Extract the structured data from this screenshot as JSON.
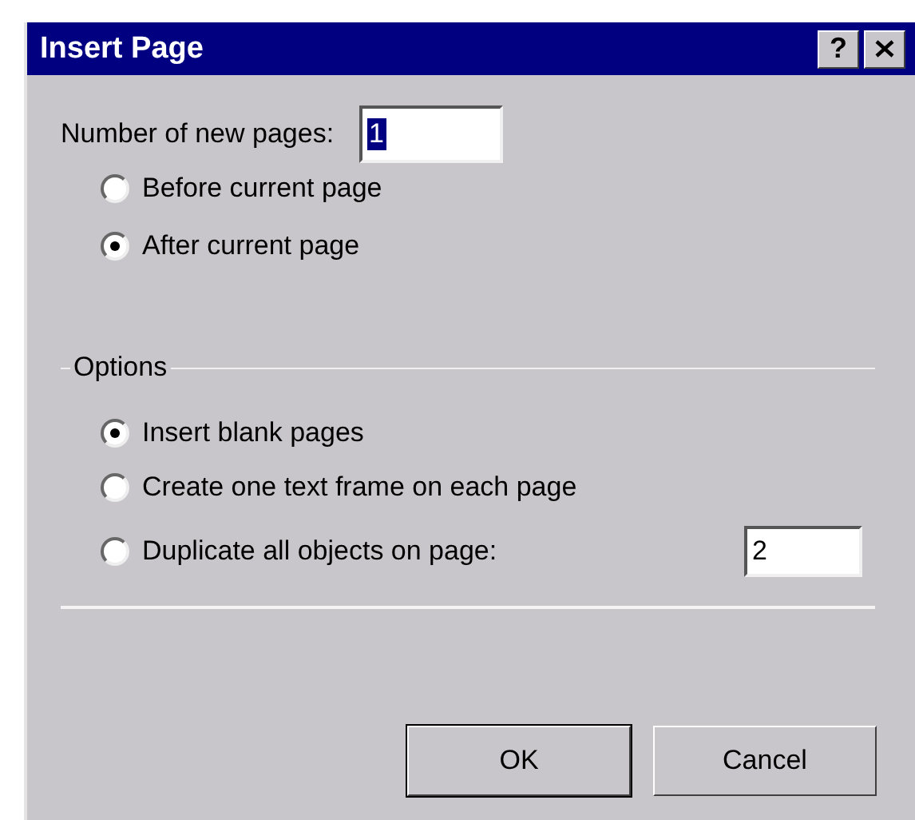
{
  "window": {
    "title": "Insert Page",
    "title_buttons": [
      {
        "kind": "help",
        "label": "?"
      },
      {
        "kind": "close"
      }
    ]
  },
  "number_of_pages": {
    "label": "Number of new pages:",
    "value": "1",
    "text_selected": true
  },
  "position": [
    {
      "label": "Before current page",
      "selected": false
    },
    {
      "label": "After current page",
      "selected": true
    }
  ],
  "options": {
    "title": "Options",
    "items": [
      {
        "label": "Insert blank pages",
        "selected": true
      },
      {
        "label": "Create one text frame on each page",
        "selected": false
      },
      {
        "label": "Duplicate all objects on page:",
        "selected": false,
        "value": "2"
      }
    ]
  },
  "buttons": [
    {
      "label": "OK",
      "default": true
    },
    {
      "label": "Cancel",
      "default": false
    }
  ]
}
